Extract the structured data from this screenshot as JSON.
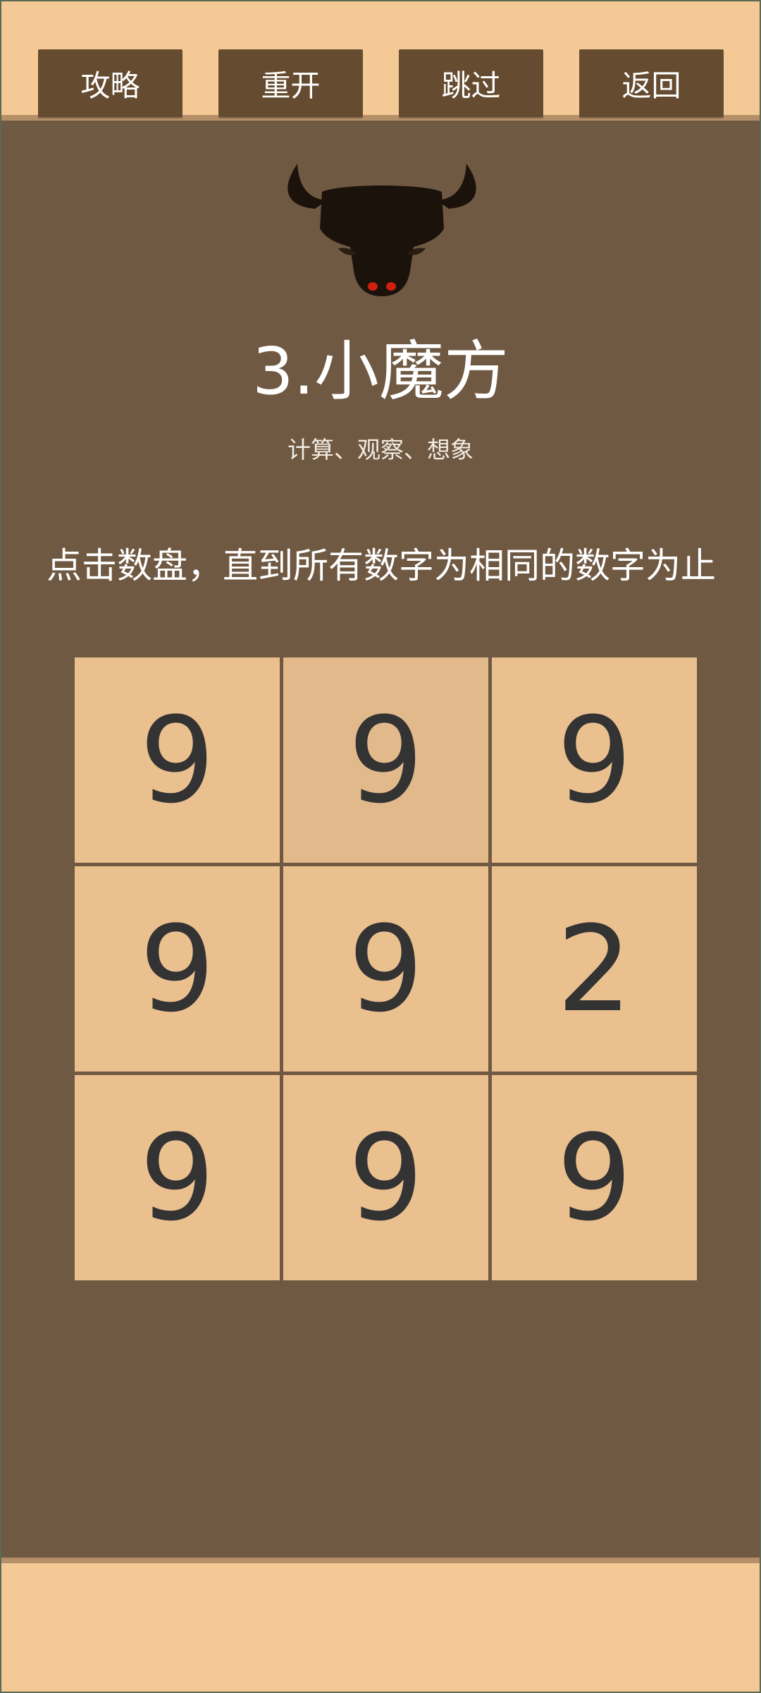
{
  "toolbar": {
    "guide_label": "攻略",
    "restart_label": "重开",
    "skip_label": "跳过",
    "back_label": "返回"
  },
  "level": {
    "title": "3.小魔方",
    "tags": "计算、观察、想象",
    "instruction": "点击数盘，直到所有数字为相同的数字为止"
  },
  "board": {
    "cells": [
      "9",
      "9",
      "9",
      "9",
      "9",
      "2",
      "9",
      "9",
      "9"
    ],
    "highlighted_index": 1
  },
  "colors": {
    "bar": "#f4c996",
    "background": "#6f5942",
    "button": "#654c31",
    "tile": "#ebc08f",
    "tile_highlight": "#e2b98b"
  },
  "icons": {
    "logo": "bull-head-icon"
  }
}
